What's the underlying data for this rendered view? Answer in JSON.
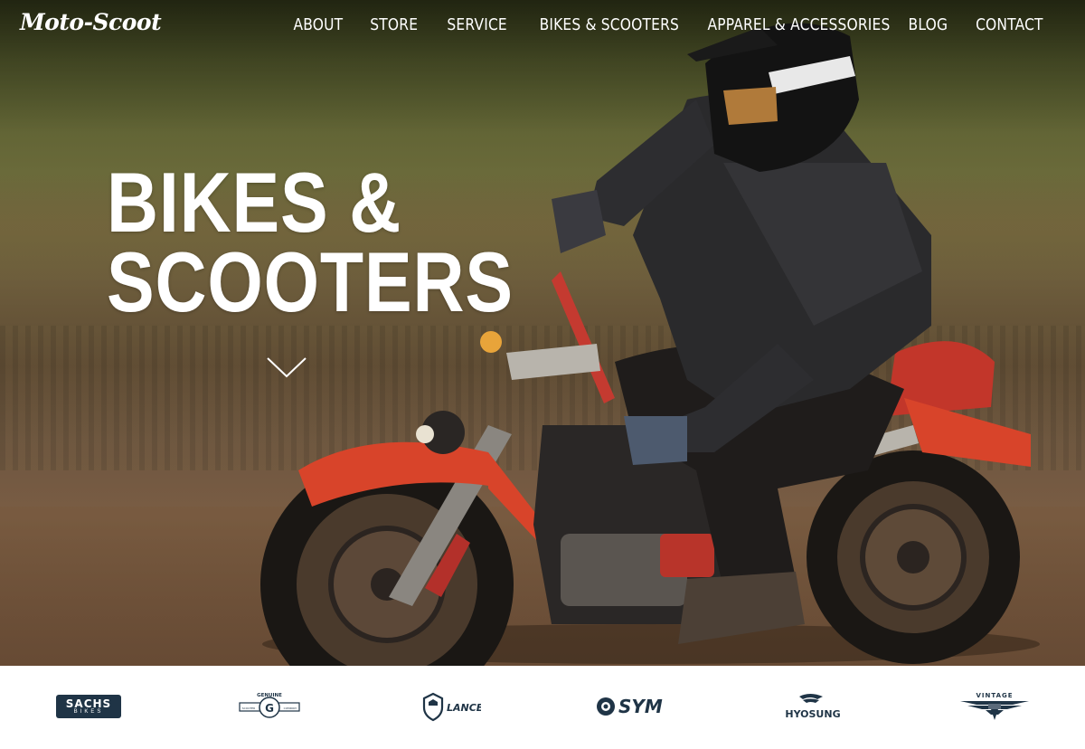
{
  "site": {
    "logo": "Moto-Scoot"
  },
  "nav": {
    "items": [
      {
        "label": "ABOUT"
      },
      {
        "label": "STORE"
      },
      {
        "label": "SERVICE"
      },
      {
        "label": "BIKES & SCOOTERS"
      },
      {
        "label": "APPAREL & ACCESSORIES"
      },
      {
        "label": "BLOG"
      },
      {
        "label": "CONTACT"
      }
    ]
  },
  "hero": {
    "title_line1": "BIKES &",
    "title_line2": "SCOOTERS",
    "scroll_icon": "chevron-down-icon"
  },
  "brands": [
    {
      "name": "sachs-bikes-logo",
      "top": "SACHS",
      "bottom": "BIKES"
    },
    {
      "name": "genuine-scooter-company-logo",
      "top": "GENUINE",
      "bottom": "SCOOTER COMPANY",
      "letter": "G"
    },
    {
      "name": "lance-logo",
      "label": "LANCE"
    },
    {
      "name": "sym-logo",
      "label": "SYM"
    },
    {
      "name": "hyosung-logo",
      "label": "HYOSUNG"
    },
    {
      "name": "vintage-logo",
      "label": "VINTAGE"
    }
  ],
  "colors": {
    "brand_navy": "#1f3446",
    "bike_red": "#d8442a",
    "nav_text": "#ffffff"
  }
}
